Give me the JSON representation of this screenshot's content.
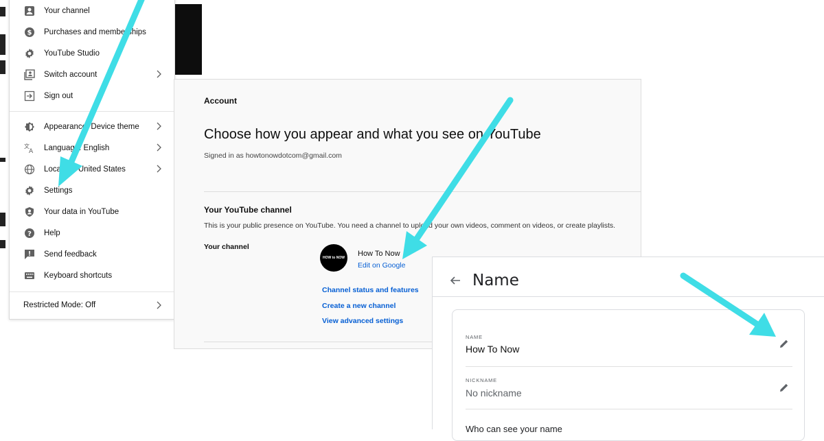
{
  "menu": {
    "items": [
      {
        "icon": "person-box-icon",
        "label": "Your channel",
        "chevron": false
      },
      {
        "icon": "dollar-circle-icon",
        "label": "Purchases and memberships",
        "chevron": false
      },
      {
        "icon": "gear-icon",
        "label": "YouTube Studio",
        "chevron": false
      },
      {
        "icon": "switch-account-icon",
        "label": "Switch account",
        "chevron": true
      },
      {
        "icon": "sign-out-icon",
        "label": "Sign out",
        "chevron": false
      },
      {
        "icon": "appearance-icon",
        "label": "Appearance: Device theme",
        "chevron": true
      },
      {
        "icon": "translate-icon",
        "label": "Language: English",
        "chevron": true
      },
      {
        "icon": "globe-icon",
        "label": "Location: United States",
        "chevron": true
      },
      {
        "icon": "gear-icon",
        "label": "Settings",
        "chevron": false
      },
      {
        "icon": "shield-person-icon",
        "label": "Your data in YouTube",
        "chevron": false
      },
      {
        "icon": "help-icon",
        "label": "Help",
        "chevron": false
      },
      {
        "icon": "feedback-icon",
        "label": "Send feedback",
        "chevron": false
      },
      {
        "icon": "keyboard-icon",
        "label": "Keyboard shortcuts",
        "chevron": false
      }
    ],
    "restricted_mode": "Restricted Mode: Off"
  },
  "account": {
    "section_label": "Account",
    "headline": "Choose how you appear and what you see on YouTube",
    "signed_in": "Signed in as howtonowdotcom@gmail.com",
    "channel_section_title": "Your YouTube channel",
    "channel_section_desc": "This is your public presence on YouTube. You need a channel to upload your own videos, comment on videos, or create playlists.",
    "your_channel_label": "Your channel",
    "avatar_text": "HOW to NOW",
    "channel_name": "How To Now",
    "edit_on_google": "Edit on Google",
    "links": [
      "Channel status and features",
      "Create a new channel",
      "View advanced settings"
    ]
  },
  "google_name": {
    "title": "Name",
    "name_label": "NAME",
    "name_value": "How To Now",
    "nickname_label": "NICKNAME",
    "nickname_value": "No nickname",
    "who_can_see": "Who can see your name"
  },
  "colors": {
    "arrow": "#3fdde6",
    "link": "#065fd4"
  }
}
